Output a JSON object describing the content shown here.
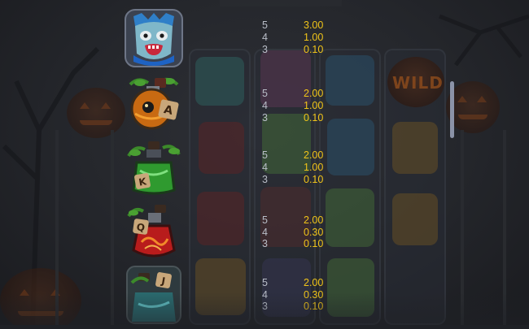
{
  "paytable": {
    "rows": [
      {
        "symbol_icon": "blue-zombie-mask-icon",
        "payouts": [
          {
            "count": "5",
            "value": "3.00"
          },
          {
            "count": "4",
            "value": "1.00"
          },
          {
            "count": "3",
            "value": "0.10"
          }
        ]
      },
      {
        "symbol_icon": "orange-potion-ace-icon",
        "payouts": [
          {
            "count": "5",
            "value": "2.00"
          },
          {
            "count": "4",
            "value": "1.00"
          },
          {
            "count": "3",
            "value": "0.10"
          }
        ]
      },
      {
        "symbol_icon": "green-potion-king-icon",
        "payouts": [
          {
            "count": "5",
            "value": "2.00"
          },
          {
            "count": "4",
            "value": "1.00"
          },
          {
            "count": "3",
            "value": "0.10"
          }
        ]
      },
      {
        "symbol_icon": "red-potion-queen-icon",
        "payouts": [
          {
            "count": "5",
            "value": "2.00"
          },
          {
            "count": "4",
            "value": "0.30"
          },
          {
            "count": "3",
            "value": "0.10"
          }
        ]
      },
      {
        "symbol_icon": "teal-potion-jack-icon",
        "payouts": [
          {
            "count": "5",
            "value": "2.00"
          },
          {
            "count": "4",
            "value": "0.30"
          },
          {
            "count": "3",
            "value": "0.10"
          }
        ]
      }
    ],
    "symbol_letters": {
      "ace": "A",
      "king": "K",
      "queen": "Q",
      "jack": "J"
    }
  },
  "background": {
    "wild_label": "WILD"
  },
  "colors": {
    "payout_value": "#f0c419",
    "payout_count": "#b9bec8",
    "background": "#1f2126",
    "scrollbar": "#8b93a8"
  }
}
